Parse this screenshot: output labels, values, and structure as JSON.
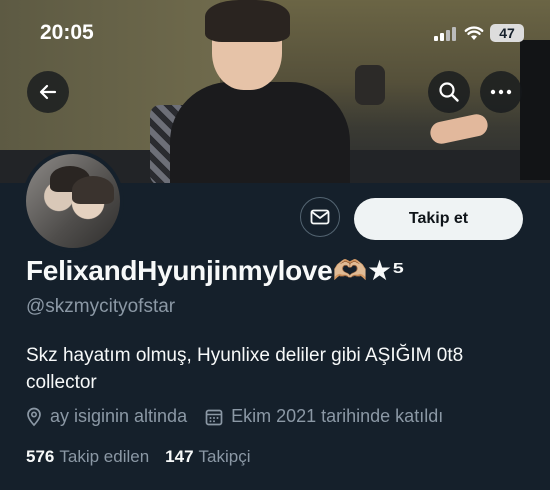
{
  "status_bar": {
    "time": "20:05",
    "battery": "47"
  },
  "profile": {
    "display_name": "FelixandHyunjinmylove🫶🏼★⁵",
    "handle": "@skzmycityofstar",
    "bio": "Skz hayatım olmuş, Hyunlixe deliler gibi AŞIĞIM 0t8 collector",
    "location": "ay isiginin altinda",
    "joined": "Ekim 2021 tarihinde katıldı",
    "following_count": "576",
    "following_label": "Takip edilen",
    "followers_count": "147",
    "followers_label": "Takipçi"
  },
  "actions": {
    "follow_label": "Takip et"
  },
  "icons": {
    "back": "back-arrow-icon",
    "search": "search-icon",
    "more": "more-icon",
    "message": "envelope-icon",
    "location": "location-pin-icon",
    "calendar": "calendar-icon"
  }
}
